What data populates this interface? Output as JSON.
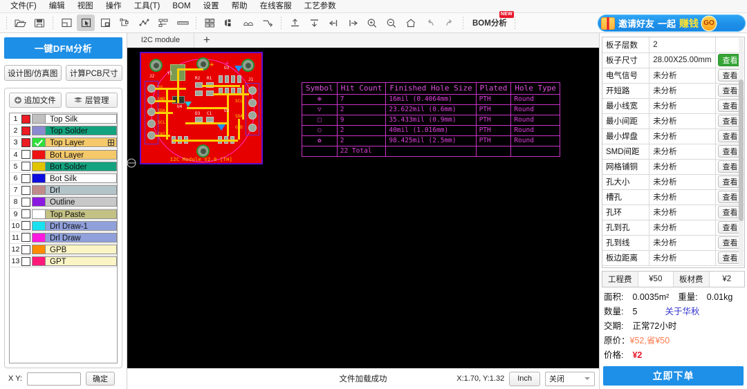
{
  "menubar": {
    "items": [
      {
        "label": "文件(F)"
      },
      {
        "label": "编辑"
      },
      {
        "label": "视图"
      },
      {
        "label": "操作"
      },
      {
        "label": "工具(T)"
      },
      {
        "label": "BOM"
      },
      {
        "label": "设置"
      },
      {
        "label": "帮助"
      },
      {
        "label": "在线客服"
      },
      {
        "label": "工艺参数"
      }
    ]
  },
  "toolbar": {
    "bom_label": "BOM分析",
    "bom_badge": "NEW",
    "icons": [
      "open-folder-icon",
      "save-icon",
      "window-icon",
      "select-pointer-icon",
      "marquee-select-icon",
      "measure-icon",
      "netlist-icon",
      "align-icon",
      "ruler-icon",
      "panelize-icon",
      "layer-stack-icon",
      "compare-icon",
      "smooth-icon",
      "import-icon",
      "export-icon",
      "align-left-icon",
      "align-right-icon",
      "zoom-in-icon",
      "zoom-out-icon",
      "home-icon",
      "undo-icon",
      "redo-icon"
    ]
  },
  "promo": {
    "text1": "邀请好友",
    "text2": "一起",
    "text3": "赚钱",
    "go": "GO"
  },
  "left": {
    "dfm_button": "一键DFM分析",
    "design_button": "设计图/仿真图",
    "size_button": "计算PCB尺寸",
    "add_file_button": "追加文件",
    "layer_manage_button": "层管理",
    "layers": [
      {
        "n": "1",
        "name": "Top Silk",
        "checked": true,
        "swatch": "#c0c0c0",
        "bg": "#ffffff",
        "check": false
      },
      {
        "n": "2",
        "name": "Top Solder",
        "checked": true,
        "swatch": "#8a8ad0",
        "bg": "#13a37f",
        "check": false
      },
      {
        "n": "3",
        "name": "Top Layer",
        "checked": true,
        "swatch": "#2fe03c",
        "bg": "#f5c96a",
        "check": true
      },
      {
        "n": "4",
        "name": "Bot Layer",
        "checked": false,
        "swatch": "#ee1111",
        "bg": "#f5c96a",
        "check": false
      },
      {
        "n": "5",
        "name": "Bot Solder",
        "checked": false,
        "swatch": "#e0c400",
        "bg": "#13a37f",
        "check": false
      },
      {
        "n": "6",
        "name": "Bot Silk",
        "checked": false,
        "swatch": "#0d0ddd",
        "bg": "#ffffff",
        "check": false
      },
      {
        "n": "7",
        "name": "Drl",
        "checked": false,
        "swatch": "#c08a8a",
        "bg": "#b3c4c9",
        "check": false
      },
      {
        "n": "8",
        "name": "Outline",
        "checked": false,
        "swatch": "#8a1ae0",
        "bg": "#c8c8c8",
        "check": false
      },
      {
        "n": "9",
        "name": "Top Paste",
        "checked": false,
        "swatch": "#ffffff",
        "bg": "#c3c184",
        "check": false
      },
      {
        "n": "10",
        "name": "Drl Draw-1",
        "checked": false,
        "swatch": "#1ae0f0",
        "bg": "#8fa0db",
        "check": false
      },
      {
        "n": "11",
        "name": "Drl Draw",
        "checked": false,
        "swatch": "#ff1adf",
        "bg": "#8fa0db",
        "check": false
      },
      {
        "n": "12",
        "name": "GPB",
        "checked": false,
        "swatch": "#ff8c00",
        "bg": "#fbf5c6",
        "check": false
      },
      {
        "n": "13",
        "name": "GPT",
        "checked": false,
        "swatch": "#ff1a7a",
        "bg": "#fbf5c6",
        "check": false
      }
    ],
    "xy_label": "X Y:",
    "xy_value": "",
    "xy_placeholder": "",
    "confirm_button": "确定"
  },
  "center": {
    "tab_label": "I2C module",
    "add_tab": "+",
    "status_message": "文件加载成功",
    "coordinates": "X:1.70, Y:1.32",
    "unit_button": "Inch",
    "select_value": "关闭",
    "pcb_silk": "I2C Module V2.0 [TH]",
    "drill_table": {
      "headers": [
        "Symbol",
        "Hit Count",
        "Finished Hole Size",
        "Plated",
        "Hole Type"
      ],
      "rows": [
        {
          "symbol": "✻",
          "hits": "7",
          "size": "16mil (0.4064mm)",
          "plated": "PTH",
          "type": "Round"
        },
        {
          "symbol": "▽",
          "hits": "2",
          "size": "23.622mil (0.6mm)",
          "plated": "PTH",
          "type": "Round"
        },
        {
          "symbol": "□",
          "hits": "9",
          "size": "35.433mil (0.9mm)",
          "plated": "PTH",
          "type": "Round"
        },
        {
          "symbol": "○",
          "hits": "2",
          "size": "40mil (1.016mm)",
          "plated": "PTH",
          "type": "Round"
        },
        {
          "symbol": "✿",
          "hits": "2",
          "size": "98.425mil (2.5mm)",
          "plated": "PTH",
          "type": "Round"
        }
      ],
      "total": "22   Total"
    }
  },
  "right": {
    "rows": [
      {
        "key": "板子层数",
        "value": "2",
        "action": "",
        "green": false
      },
      {
        "key": "板子尺寸",
        "value": "28.00X25.00mm",
        "action": "查看",
        "green": true
      },
      {
        "key": "电气信号",
        "value": "未分析",
        "action": "查看",
        "green": false
      },
      {
        "key": "开短路",
        "value": "未分析",
        "action": "查看",
        "green": false
      },
      {
        "key": "最小线宽",
        "value": "未分析",
        "action": "查看",
        "green": false
      },
      {
        "key": "最小间距",
        "value": "未分析",
        "action": "查看",
        "green": false
      },
      {
        "key": "最小焊盘",
        "value": "未分析",
        "action": "查看",
        "green": false
      },
      {
        "key": "SMD间距",
        "value": "未分析",
        "action": "查看",
        "green": false
      },
      {
        "key": "网格铺铜",
        "value": "未分析",
        "action": "查看",
        "green": false
      },
      {
        "key": "孔大小",
        "value": "未分析",
        "action": "查看",
        "green": false
      },
      {
        "key": "槽孔",
        "value": "未分析",
        "action": "查看",
        "green": false
      },
      {
        "key": "孔环",
        "value": "未分析",
        "action": "查看",
        "green": false
      },
      {
        "key": "孔到孔",
        "value": "未分析",
        "action": "查看",
        "green": false
      },
      {
        "key": "孔到线",
        "value": "未分析",
        "action": "查看",
        "green": false
      },
      {
        "key": "板边距离",
        "value": "未分析",
        "action": "查看",
        "green": false
      }
    ],
    "fees": [
      {
        "label": "工程费",
        "amount": "¥50"
      },
      {
        "label": "板材费",
        "amount": "¥2"
      }
    ],
    "area_label": "面积:",
    "area_value": "0.0035m²",
    "weight_label": "重量:",
    "weight_value": "0.01kg",
    "qty_label": "数量:",
    "qty_value": "5",
    "about_link": "关于华秋",
    "lead_label": "交期:",
    "lead_value": "正常72小时",
    "orig_label": "原价：",
    "orig_value": "¥52",
    "save_value": ",省¥50",
    "price_label": "价格:",
    "price_value": "¥2",
    "order_button": "立即下单"
  }
}
